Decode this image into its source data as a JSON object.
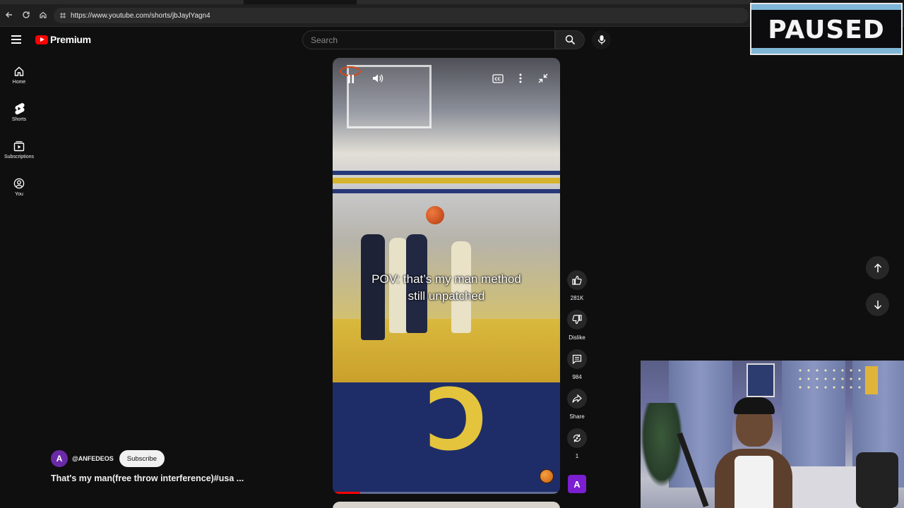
{
  "browser": {
    "url": "https://www.youtube.com/shorts/jbJaylYagn4"
  },
  "header": {
    "logo_text": "Premium",
    "search_placeholder": "Search"
  },
  "sidebar": {
    "items": [
      {
        "label": "Home",
        "icon": "home-icon"
      },
      {
        "label": "Shorts",
        "icon": "shorts-icon"
      },
      {
        "label": "Subscriptions",
        "icon": "subscriptions-icon"
      },
      {
        "label": "You",
        "icon": "you-icon"
      }
    ]
  },
  "video": {
    "caption_line1": "POV: that’s my man method",
    "caption_line2": "still unpatched",
    "progress": 0.12
  },
  "actions": {
    "like_count": "281K",
    "dislike_label": "Dislike",
    "comment_count": "984",
    "share_label": "Share",
    "remix_count": "1",
    "channel_tile_letter": "A"
  },
  "channel": {
    "avatar_letter": "A",
    "handle": "@ANFEDEOS",
    "subscribe_label": "Subscribe",
    "title": "That's my man(free throw interference)#usa ..."
  },
  "overlay": {
    "paused_text": "PAUSED"
  },
  "colors": {
    "background": "#0f0f0f",
    "brand_red": "#ff0000",
    "channel_purple": "#7b1fd0"
  }
}
